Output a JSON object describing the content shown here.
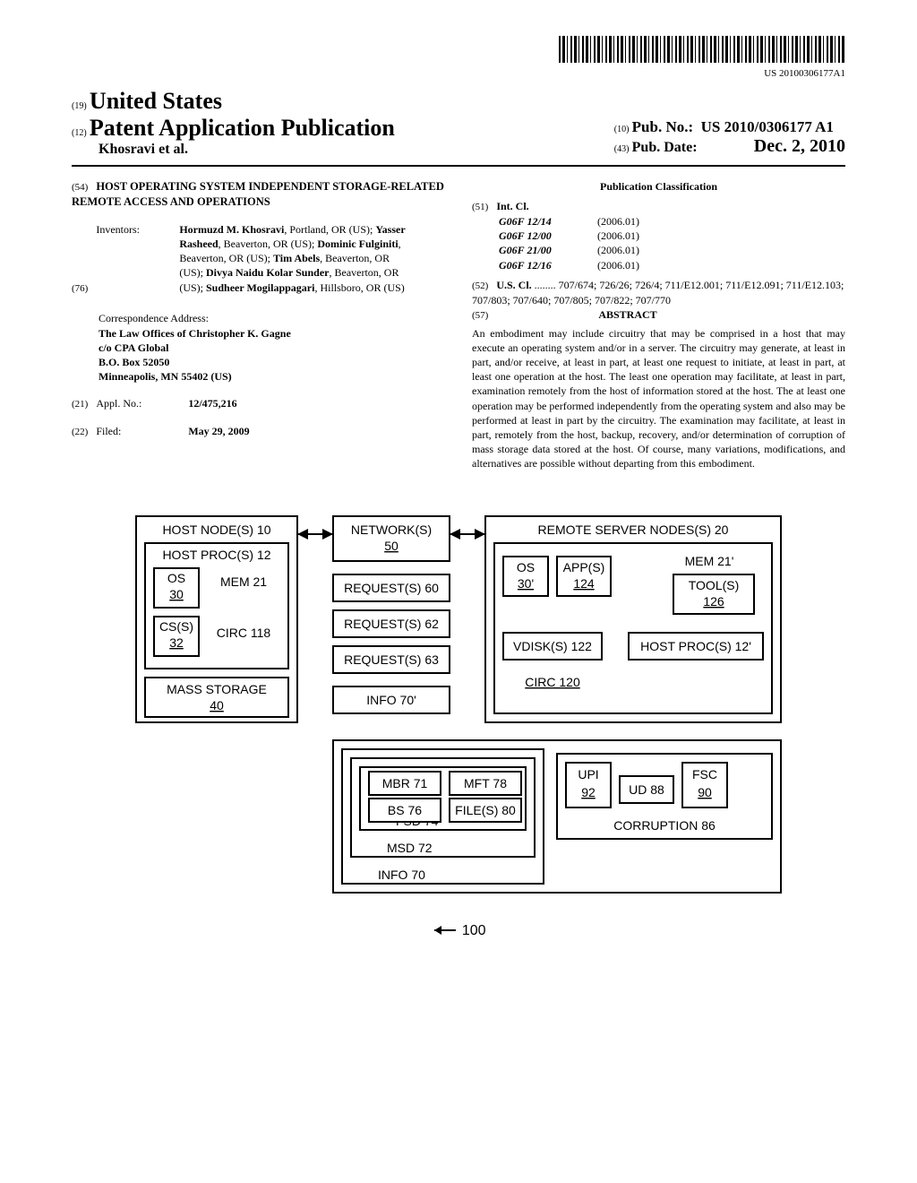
{
  "barcode_number": "US 20100306177A1",
  "header": {
    "country_num": "(19)",
    "country": "United States",
    "pub_num": "(12)",
    "pub_type": "Patent Application Publication",
    "author_line": "Khosravi et al.",
    "pubno_num": "(10)",
    "pubno_label": "Pub. No.:",
    "pubno_val": "US 2010/0306177 A1",
    "pubdate_num": "(43)",
    "pubdate_label": "Pub. Date:",
    "pubdate_val": "Dec. 2, 2010"
  },
  "title": {
    "num": "(54)",
    "text": "HOST OPERATING SYSTEM INDEPENDENT STORAGE-RELATED REMOTE ACCESS AND OPERATIONS"
  },
  "inventors": {
    "num": "(76)",
    "label": "Inventors:",
    "text": "Hormuzd M. Khosravi, Portland, OR (US); Yasser Rasheed, Beaverton, OR (US); Dominic Fulginiti, Beaverton, OR (US); Tim Abels, Beaverton, OR (US); Divya Naidu Kolar Sunder, Beaverton, OR (US); Sudheer Mogilappagari, Hillsboro, OR (US)"
  },
  "correspondence": {
    "label": "Correspondence Address:",
    "line1": "The Law Offices of Christopher K. Gagne",
    "line2": "c/o CPA Global",
    "line3": "B.O. Box 52050",
    "line4": "Minneapolis, MN 55402 (US)"
  },
  "appl": {
    "num": "(21)",
    "label": "Appl. No.:",
    "val": "12/475,216"
  },
  "filed": {
    "num": "(22)",
    "label": "Filed:",
    "val": "May 29, 2009"
  },
  "classification": {
    "heading": "Publication Classification",
    "intcl_num": "(51)",
    "intcl_label": "Int. Cl.",
    "intcl": [
      {
        "code": "G06F 12/14",
        "year": "(2006.01)"
      },
      {
        "code": "G06F 12/00",
        "year": "(2006.01)"
      },
      {
        "code": "G06F 21/00",
        "year": "(2006.01)"
      },
      {
        "code": "G06F 12/16",
        "year": "(2006.01)"
      }
    ],
    "uscl_num": "(52)",
    "uscl_label": "U.S. Cl.",
    "uscl_val": "........ 707/674; 726/26; 726/4; 711/E12.001; 711/E12.091; 711/E12.103; 707/803; 707/640; 707/805; 707/822; 707/770"
  },
  "abstract": {
    "num": "(57)",
    "heading": "ABSTRACT",
    "body": "An embodiment may include circuitry that may be comprised in a host that may execute an operating system and/or in a server. The circuitry may generate, at least in part, and/or receive, at least in part, at least one request to initiate, at least in part, at least one operation at the host. The least one operation may facilitate, at least in part, examination remotely from the host of information stored at the host. The at least one operation may be performed independently from the operating system and also may be performed at least in part by the circuitry. The examination may facilitate, at least in part, remotely from the host, backup, recovery, and/or determination of corruption of mass storage data stored at the host. Of course, many variations, modifications, and alternatives are possible without departing from this embodiment."
  },
  "figure": {
    "host_nodes": "HOST NODE(S) 10",
    "host_proc": "HOST PROC(S) 12",
    "os": "OS",
    "os_num": "30",
    "mem": "MEM 21",
    "css": "CS(S)",
    "css_num": "32",
    "circ118": "CIRC 118",
    "mass_storage": "MASS STORAGE",
    "mass_storage_num": "40",
    "networks": "NETWORK(S)",
    "networks_num": "50",
    "request60": "REQUEST(S) 60",
    "request62": "REQUEST(S) 62",
    "request63": "REQUEST(S) 63",
    "info70p": "INFO 70'",
    "remote": "REMOTE SERVER NODES(S) 20",
    "os_p": "OS",
    "os_p_num": "30'",
    "apps": "APP(S)",
    "apps_num": "124",
    "mem_p": "MEM 21'",
    "tools": "TOOL(S)",
    "tools_num": "126",
    "vdisk": "VDISK(S) 122",
    "host_proc_p": "HOST PROC(S) 12'",
    "circ120": "CIRC 120",
    "info70": "INFO 70",
    "msd": "MSD 72",
    "fsd": "FSD 74",
    "mbr": "MBR 71",
    "bs": "BS 76",
    "mft": "MFT 78",
    "files": "FILE(S) 80",
    "upi": "UPI",
    "upi_num": "92",
    "ud": "UD 88",
    "fsc": "FSC",
    "fsc_num": "90",
    "corruption": "CORRUPTION 86",
    "ref100": "100"
  }
}
